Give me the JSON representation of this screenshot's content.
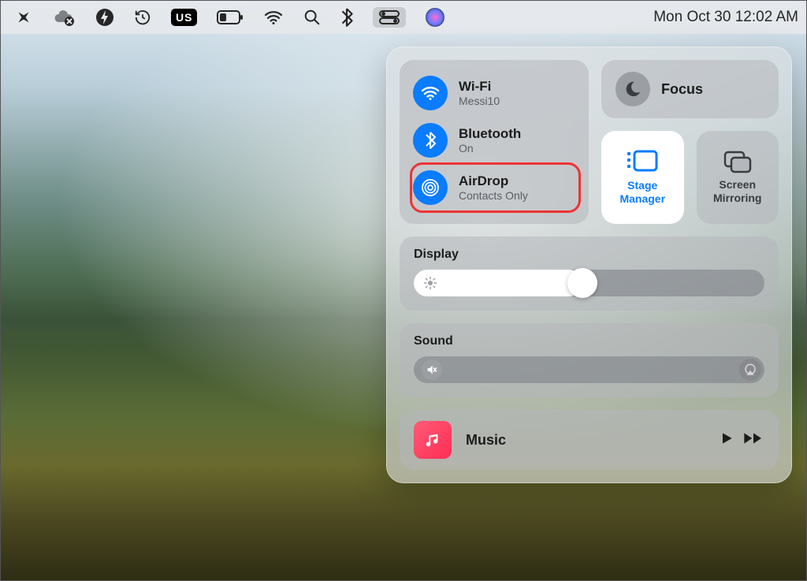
{
  "menubar": {
    "clock": "Mon Oct 30  12:02 AM",
    "inputSource": "US"
  },
  "controlCenter": {
    "wifi": {
      "label": "Wi-Fi",
      "status": "Messi10"
    },
    "bluetooth": {
      "label": "Bluetooth",
      "status": "On"
    },
    "airdrop": {
      "label": "AirDrop",
      "status": "Contacts Only"
    },
    "focus": {
      "label": "Focus"
    },
    "stageManager": {
      "line1": "Stage",
      "line2": "Manager"
    },
    "screenMirroring": {
      "line1": "Screen",
      "line2": "Mirroring"
    },
    "display": {
      "label": "Display",
      "value": 48
    },
    "sound": {
      "label": "Sound",
      "value": 0
    },
    "music": {
      "label": "Music"
    }
  }
}
